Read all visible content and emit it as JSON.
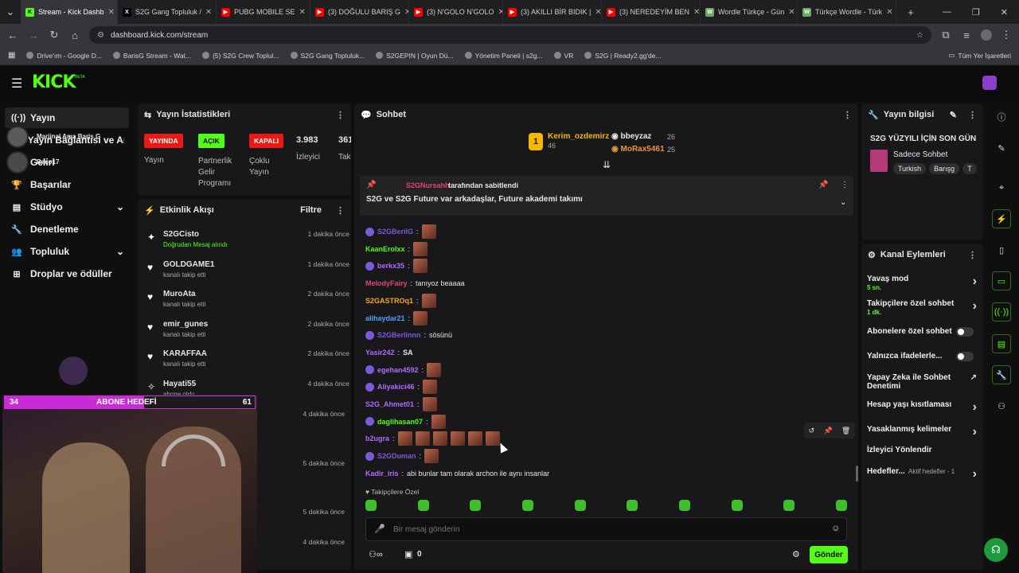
{
  "browser": {
    "tabs": [
      {
        "label": "Stream - Kick Dashb",
        "favicon": "kick",
        "color": "#53fc18",
        "active": true
      },
      {
        "label": "S2G Gang Topluluk /",
        "favicon": "x",
        "color": "#ffffff"
      },
      {
        "label": "PUBG MOBILE SE",
        "favicon": "youtube",
        "color": "#ff0000"
      },
      {
        "label": "(3) DOĞULU BARIŞ G",
        "favicon": "youtube",
        "color": "#ff0000"
      },
      {
        "label": "(3) N'GOLO N'GOLO",
        "favicon": "youtube",
        "color": "#ff0000"
      },
      {
        "label": "(3) AKILLI BİR BIDIK |",
        "favicon": "youtube",
        "color": "#ff0000"
      },
      {
        "label": "(3) NEREDEYİM BEN",
        "favicon": "youtube",
        "color": "#ff0000"
      },
      {
        "label": "Wordle Türkçe - Gün",
        "favicon": "w",
        "color": "#6aaa64"
      },
      {
        "label": "Türkçe Wordle - Türk",
        "favicon": "w",
        "color": "#6aaa64"
      }
    ],
    "url": "dashboard.kick.com/stream",
    "bookmarks": [
      "Drive'ım - Google D...",
      "BarisG Stream - Wat...",
      "(5) S2G Crew Toplul...",
      "S2G Gang Topluluk...",
      "S2GEPIN | Oyun Dü...",
      "Yönetim Paneli | s2g...",
      "VR",
      "S2G | Ready2.gg'de..."
    ],
    "all_bookmarks": "Tüm Yer İşaretleri"
  },
  "kick": {
    "logo": "KICK",
    "beta": "BETA"
  },
  "sidebar": {
    "items": [
      {
        "label": "Yayın",
        "icon": "broadcast-icon"
      },
      {
        "label": "Yayın Bağlantısı ve Anahtarı",
        "icon": "key-icon"
      },
      {
        "label": "Geliri",
        "icon": "money-icon"
      },
      {
        "label": "Başarılar",
        "icon": "trophy-icon"
      },
      {
        "label": "Stüdyo",
        "icon": "studio-icon"
      },
      {
        "label": "Denetleme",
        "icon": "wrench-icon"
      },
      {
        "label": "Topluluk",
        "icon": "people-icon"
      },
      {
        "label": "Droplar ve ödüller",
        "icon": "gift-icon"
      }
    ],
    "guests": [
      "Marjinal Ama Baris G",
      "Raco17"
    ]
  },
  "stats": {
    "title": "Yayın İstatistikleri",
    "cols": [
      {
        "badge": "YAYINDA",
        "label": "Yayın",
        "color": "#e91916"
      },
      {
        "badge": "AÇIK",
        "label": "Partnerlik Gelir Programı",
        "color": "#53fc18"
      },
      {
        "badge": "KAPALI",
        "label": "Çoklu Yayın",
        "color": "#e91916"
      },
      {
        "value": "3.983",
        "label": "İzleyici"
      },
      {
        "value": "361.",
        "label": "Takı"
      }
    ]
  },
  "activity": {
    "title": "Etkinlik Akışı",
    "filter": "Filtre",
    "events": [
      {
        "name": "S2GCisto",
        "desc": "Doğrudan Mesaj alındı",
        "time": "1 dakika önce",
        "icon": "sparkle-icon"
      },
      {
        "name": "GOLDGAME1",
        "desc": "kanalı takip etti",
        "time": "1 dakika önce",
        "icon": "heart-icon"
      },
      {
        "name": "MuroAta",
        "desc": "kanalı takip etti",
        "time": "2 dakika önce",
        "icon": "heart-icon"
      },
      {
        "name": "emir_gunes",
        "desc": "kanalı takip etti",
        "time": "2 dakika önce",
        "icon": "heart-icon"
      },
      {
        "name": "KARAFFAA",
        "desc": "kanalı takip etti",
        "time": "2 dakika önce",
        "icon": "heart-icon"
      },
      {
        "name": "Hayati55",
        "desc": "abone oldu",
        "time": "4 dakika önce",
        "icon": "star-icon"
      }
    ],
    "more_times": [
      "4 dakika önce",
      "5 dakika önce",
      "5 dakika önce",
      "4 dakika önce"
    ]
  },
  "goal": {
    "left": "34",
    "title": "ABONE HEDEFİ",
    "right": "61"
  },
  "chat": {
    "title": "Sohbet",
    "top": [
      {
        "name": "Kerim_ozdemirz",
        "count": "46"
      },
      {
        "name": "bbeyzaz",
        "count": "26"
      },
      {
        "name": "MoRax5461",
        "count": "25"
      }
    ],
    "pinned_by": "S2GNursahh",
    "pinned_suffix": "tarafından sabitlendi",
    "pinned_text": "S2G ve S2G Future var arkadaşlar, Future akademi takımı",
    "messages": [
      {
        "user": "S2GBerilG",
        "color": "#7a5ad8",
        "text": "",
        "emotes": 1
      },
      {
        "user": "KaanErolxx",
        "color": "#53fc18",
        "text": "",
        "emotes": 1
      },
      {
        "user": "berkx35",
        "color": "#b36bff",
        "text": "",
        "emotes": 1
      },
      {
        "user": "MelodyFairy",
        "color": "#e0457b",
        "text": "tanıyoz beaaaa",
        "emotes": 0
      },
      {
        "user": "S2GASTROq1",
        "color": "#f5a623",
        "text": "",
        "emotes": 1
      },
      {
        "user": "alihaydar21",
        "color": "#4aa3ff",
        "text": "",
        "emotes": 1
      },
      {
        "user": "S2GBerlinnn",
        "color": "#7a5ad8",
        "text": "sösünü",
        "emotes": 0
      },
      {
        "user": "Yasir242",
        "color": "#b36bff",
        "text": "SA",
        "emotes": 0
      },
      {
        "user": "egehan4592",
        "color": "#b36bff",
        "text": "",
        "emotes": 1
      },
      {
        "user": "Aliyakici46",
        "color": "#b36bff",
        "text": "",
        "emotes": 1
      },
      {
        "user": "S2G_Ahmet01",
        "color": "#b36bff",
        "text": "",
        "emotes": 1
      },
      {
        "user": "daglihasan07",
        "color": "#53fc18",
        "text": "",
        "emotes": 1
      },
      {
        "user": "b2ugra",
        "color": "#b36bff",
        "text": "",
        "emotes": 6
      },
      {
        "user": "S2GDuman",
        "color": "#7a5ad8",
        "text": "",
        "emotes": 1
      },
      {
        "user": "Kadir_iris",
        "color": "#b36bff",
        "text": "abi bunlar tam olarak archon ile aynı insanlar",
        "emotes": 0
      }
    ],
    "followers_only": "Takipçilere Özel",
    "placeholder": "Bir mesaj gönderin",
    "points": "0",
    "send": "Gönder"
  },
  "info": {
    "title": "Yayın bilgisi",
    "stream_title": "S2G YÜZYILI İÇİN SON GÜN",
    "category": "Sadece Sohbet",
    "tags": [
      "Turkish",
      "Barışg",
      "T"
    ]
  },
  "actions": {
    "title": "Kanal Eylemleri",
    "items": [
      {
        "label": "Yavaş mod",
        "sub": "5 sn.",
        "type": "chevron"
      },
      {
        "label": "Takipçilere özel sohbet",
        "sub": "1 dk.",
        "type": "chevron"
      },
      {
        "label": "Abonelere özel sohbet",
        "sub": "",
        "type": "toggle"
      },
      {
        "label": "Yalnızca ifadelerle...",
        "sub": "",
        "type": "toggle"
      },
      {
        "label": "Yapay Zeka ile Sohbet Denetimi",
        "sub": "",
        "type": "external"
      },
      {
        "label": "Hesap yaşı kısıtlaması",
        "sub": "",
        "type": "chevron"
      },
      {
        "label": "Yasaklanmış kelimeler",
        "sub": "",
        "type": "chevron"
      },
      {
        "label": "İzleyici Yönlendir",
        "sub": "",
        "type": "none"
      },
      {
        "label": "Hedefler...",
        "sub": "",
        "type": "goals"
      }
    ],
    "goals_status": "Aktif hedefler - 1"
  },
  "colors": {
    "brand": "#53fc18",
    "live": "#e91916",
    "panel": "#18181b",
    "goal": "#c92bd6"
  }
}
